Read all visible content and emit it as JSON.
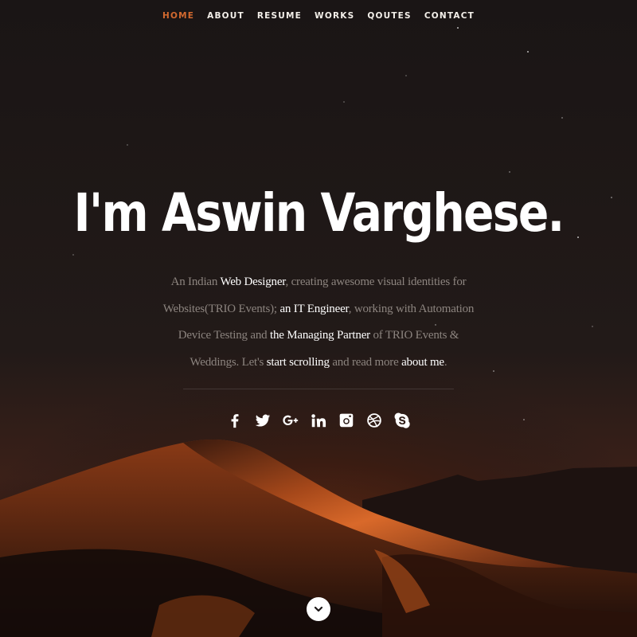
{
  "nav": {
    "items": [
      {
        "label": "HOME",
        "active": true
      },
      {
        "label": "ABOUT",
        "active": false
      },
      {
        "label": "RESUME",
        "active": false
      },
      {
        "label": "WORKS",
        "active": false
      },
      {
        "label": "QOUTES",
        "active": false
      },
      {
        "label": "CONTACT",
        "active": false
      }
    ],
    "active_color": "#d2692f"
  },
  "hero": {
    "title": "I'm Aswin Varghese."
  },
  "intro": {
    "p1": "An Indian ",
    "h1": "Web Designer",
    "p2": ", creating awesome visual identities for Websites(TRIO Events); ",
    "h2": "an IT Engineer",
    "p3": ", working with Automation Device Testing and ",
    "h3": "the Managing Partner",
    "p4": " of TRIO Events & Weddings. Let's ",
    "h4": "start scrolling",
    "p5": " and read more ",
    "h5": "about me",
    "p6": "."
  },
  "social": [
    {
      "icon": "facebook-icon"
    },
    {
      "icon": "twitter-icon"
    },
    {
      "icon": "google-plus-icon"
    },
    {
      "icon": "linkedin-icon"
    },
    {
      "icon": "instagram-icon"
    },
    {
      "icon": "dribbble-icon"
    },
    {
      "icon": "skype-icon"
    }
  ],
  "scroll_button": {
    "icon": "chevron-down-icon"
  },
  "colors": {
    "background": "#1b1616",
    "dune": "#c85a1e",
    "text_muted": "#8c847f"
  }
}
